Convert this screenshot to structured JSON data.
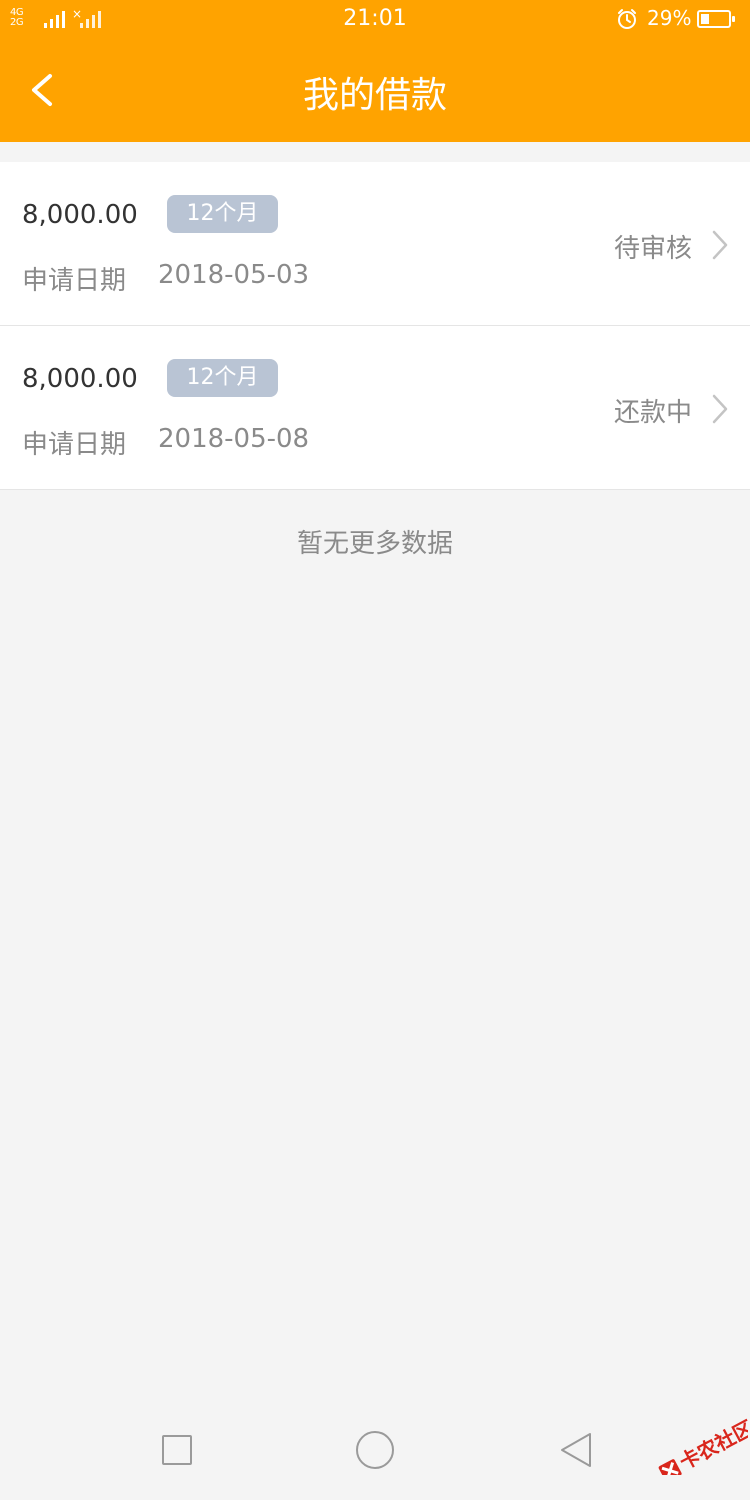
{
  "status_bar": {
    "network_top": "4G",
    "network_bottom": "2G",
    "time": "21:01",
    "battery_percent": "29%",
    "battery_level": 0.29
  },
  "header": {
    "title": "我的借款",
    "back_icon": "chevron-left-icon"
  },
  "loans": [
    {
      "amount": "8,000.00",
      "term": "12个月",
      "date_label": "申请日期",
      "date": "2018-05-03",
      "status": "待审核"
    },
    {
      "amount": "8,000.00",
      "term": "12个月",
      "date_label": "申请日期",
      "date": "2018-05-08",
      "status": "还款中"
    }
  ],
  "footer_text": "暂无更多数据",
  "nav_bar": {
    "icons": [
      "square-recent-icon",
      "circle-home-icon",
      "triangle-back-icon"
    ]
  },
  "watermark": {
    "text": "卡农社区"
  },
  "colors": {
    "accent": "#ffa300",
    "badge": "#b9c4d4",
    "background": "#f4f4f4",
    "text_muted": "#8a8a8a"
  }
}
